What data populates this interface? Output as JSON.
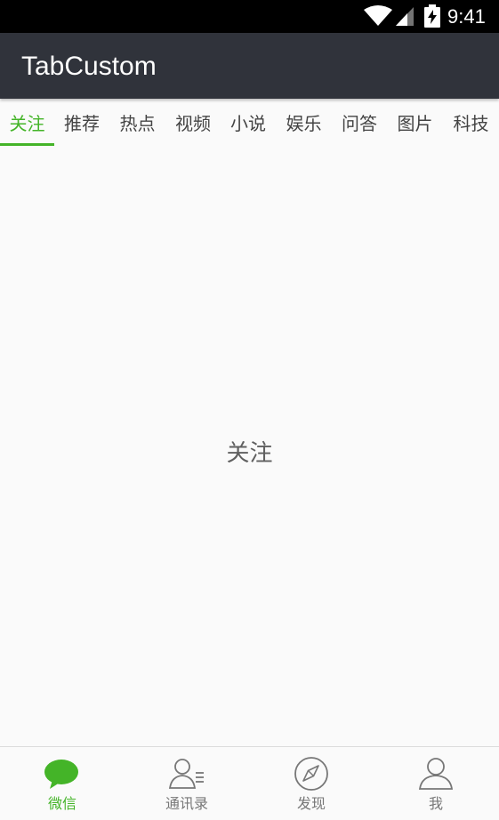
{
  "status_bar": {
    "time": "9:41",
    "icons": [
      "wifi-icon",
      "cell-signal-icon",
      "battery-charging-icon"
    ]
  },
  "app_bar": {
    "title": "TabCustom",
    "background_color": "#30333b"
  },
  "tabs": {
    "selected_index": 0,
    "accent_color": "#44b428",
    "items": [
      {
        "label": "关注"
      },
      {
        "label": "推荐"
      },
      {
        "label": "热点"
      },
      {
        "label": "视频"
      },
      {
        "label": "小说"
      },
      {
        "label": "娱乐"
      },
      {
        "label": "问答"
      },
      {
        "label": "图片"
      },
      {
        "label": "科技"
      }
    ]
  },
  "content": {
    "label": "关注"
  },
  "bottom_nav": {
    "selected_index": 0,
    "items": [
      {
        "label": "微信",
        "icon": "chat-bubble-icon"
      },
      {
        "label": "通讯录",
        "icon": "contacts-icon"
      },
      {
        "label": "发现",
        "icon": "compass-icon"
      },
      {
        "label": "我",
        "icon": "person-icon"
      }
    ]
  }
}
